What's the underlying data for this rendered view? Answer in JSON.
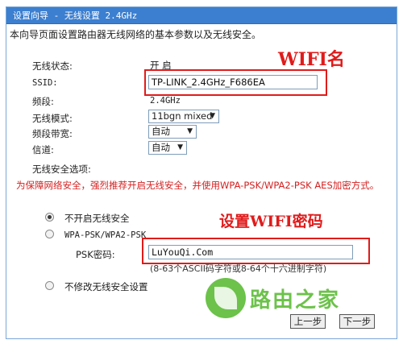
{
  "title": "设置向导 - 无线设置 2.4GHz",
  "intro": "本向导页面设置路由器无线网络的基本参数以及无线安全。",
  "status": {
    "label": "无线状态:",
    "value": "开 启"
  },
  "ssid": {
    "label": "SSID:",
    "value": "TP-LINK_2.4GHz_F686EA"
  },
  "band": {
    "label": "频段:",
    "value": "2.4GHz"
  },
  "mode": {
    "label": "无线模式:",
    "value": "11bgn mixed"
  },
  "bandwidth": {
    "label": "频段带宽:",
    "value": "自动"
  },
  "channel": {
    "label": "信道:",
    "value": "自动"
  },
  "security": {
    "label": "无线安全选项:",
    "warning": "为保障网络安全，强烈推荐开启无线安全，并使用WPA-PSK/WPA2-PSK AES加密方式。",
    "opt_off": "不开启无线安全",
    "opt_wpa": "WPA-PSK/WPA2-PSK",
    "psk_label": "PSK密码:",
    "psk_value": "LuYouQi.Com",
    "psk_hint": "(8-63个ASCII码字符或8-64个十六进制字符)",
    "opt_keep": "不修改无线安全设置"
  },
  "annotations": {
    "wifi_name": "WIFI名",
    "wifi_password": "设置WIFI密码"
  },
  "watermark": "路由之家",
  "buttons": {
    "prev": "上一步",
    "next": "下一步"
  },
  "colors": {
    "title_bar": "#3c7fd0",
    "annotation_red": "#e01b1b",
    "logo_green": "#6cc24a"
  },
  "selected_security_option": "不开启无线安全"
}
